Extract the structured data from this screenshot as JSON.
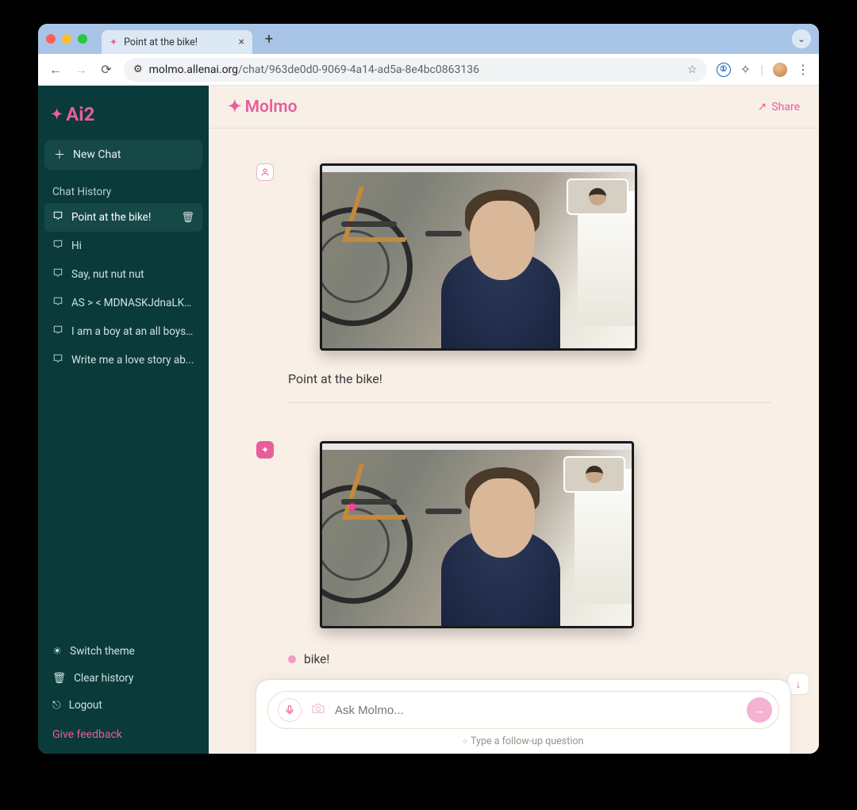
{
  "browser": {
    "tab_title": "Point at the bike!",
    "url_host": "molmo.allenai.org",
    "url_path": "/chat/963de0d0-9069-4a14-ad5a-8e4bc0863136"
  },
  "sidebar": {
    "logo": "Ai2",
    "new_chat": "New Chat",
    "history_header": "Chat History",
    "history": [
      {
        "label": "Point at the bike!",
        "active": true
      },
      {
        "label": "Hi",
        "active": false
      },
      {
        "label": "Say, nut nut nut",
        "active": false
      },
      {
        "label": "AS > < MDNASKJdnaLKDJ...",
        "active": false
      },
      {
        "label": "I am a boy at an all boys ...",
        "active": false
      },
      {
        "label": "Write me a love story ab...",
        "active": false
      }
    ],
    "switch_theme": "Switch theme",
    "clear_history": "Clear history",
    "logout": "Logout",
    "feedback": "Give feedback"
  },
  "header": {
    "app_name": "Molmo",
    "share": "Share"
  },
  "conversation": {
    "user_text": "Point at the bike!",
    "ai_answer": "bike!"
  },
  "composer": {
    "placeholder": "Ask Molmo...",
    "hint": "Type a follow-up question"
  }
}
